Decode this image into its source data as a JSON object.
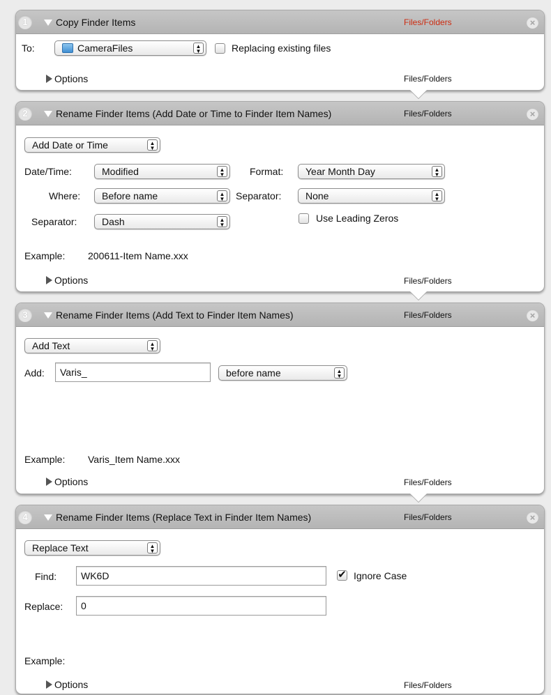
{
  "actions": [
    {
      "step": "1",
      "title": "Copy Finder Items",
      "type_header": "Files/Folders",
      "to_label": "To:",
      "to_value": "CameraFiles",
      "replacing_label": "Replacing existing files",
      "options_label": "Options",
      "type_footer": "Files/Folders"
    },
    {
      "step": "2",
      "title": "Rename Finder Items (Add Date or Time to Finder Item Names)",
      "type_header": "Files/Folders",
      "mode": "Add Date or Time",
      "datetime_label": "Date/Time:",
      "datetime_value": "Modified",
      "format_label": "Format:",
      "format_value": "Year Month Day",
      "where_label": "Where:",
      "where_value": "Before name",
      "separator_label": "Separator:",
      "separator_value": "None",
      "separator2_label": "Separator:",
      "separator2_value": "Dash",
      "leading_zeros_label": "Use Leading Zeros",
      "example_label": "Example:",
      "example_value": "200611-Item Name.xxx",
      "options_label": "Options",
      "type_footer": "Files/Folders"
    },
    {
      "step": "3",
      "title": "Rename Finder Items (Add Text to Finder Item Names)",
      "type_header": "Files/Folders",
      "mode": "Add Text",
      "add_label": "Add:",
      "add_value": "Varis_",
      "position_value": "before name",
      "example_label": "Example:",
      "example_value": "Varis_Item Name.xxx",
      "options_label": "Options",
      "type_footer": "Files/Folders"
    },
    {
      "step": "4",
      "title": "Rename Finder Items (Replace Text in Finder Item Names)",
      "type_header": "Files/Folders",
      "mode": "Replace Text",
      "find_label": "Find:",
      "find_value": "WK6D",
      "ignore_case_label": "Ignore Case",
      "ignore_case_checked": true,
      "replace_label": "Replace:",
      "replace_value": "0",
      "example_label": "Example:",
      "example_value": "",
      "options_label": "Options",
      "type_footer": "Files/Folders"
    }
  ],
  "icons": {
    "close": "close-icon",
    "folder": "folder-icon",
    "disclosure_open": "disclosure-down-icon",
    "disclosure_closed": "disclosure-right-icon",
    "stepper": "popup-stepper-icon",
    "check_mark": "✔"
  },
  "colors": {
    "header_bg": "#bdbdbd",
    "input_type_red": "#cc2b10",
    "background": "#ececec"
  }
}
